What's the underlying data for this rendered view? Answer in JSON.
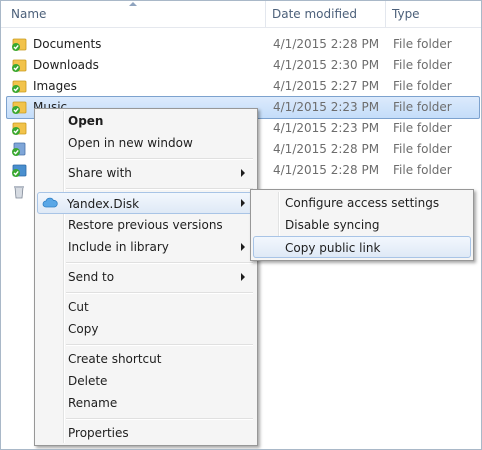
{
  "columns": {
    "name": "Name",
    "date": "Date modified",
    "type": "Type"
  },
  "rows": [
    {
      "name": "Documents",
      "date": "4/1/2015 2:28 PM",
      "type": "File folder"
    },
    {
      "name": "Downloads",
      "date": "4/1/2015 2:30 PM",
      "type": "File folder"
    },
    {
      "name": "Images",
      "date": "4/1/2015 2:27 PM",
      "type": "File folder"
    },
    {
      "name": "Music",
      "date": "4/1/2015 2:23 PM",
      "type": "File folder"
    },
    {
      "name": "",
      "date": "4/1/2015 2:23 PM",
      "type": "File folder"
    },
    {
      "name": "",
      "date": "4/1/2015 2:28 PM",
      "type": "File folder"
    },
    {
      "name": "",
      "date": "4/1/2015 2:28 PM",
      "type": "File folder"
    }
  ],
  "context_menu": {
    "open": "Open",
    "open_new_window": "Open in new window",
    "share_with": "Share with",
    "yandex_disk": "Yandex.Disk",
    "restore_previous": "Restore previous versions",
    "include_library": "Include in library",
    "send_to": "Send to",
    "cut": "Cut",
    "copy": "Copy",
    "create_shortcut": "Create shortcut",
    "delete": "Delete",
    "rename": "Rename",
    "properties": "Properties"
  },
  "submenu": {
    "configure_access": "Configure access settings",
    "disable_syncing": "Disable syncing",
    "copy_public_link": "Copy public link"
  },
  "colors": {
    "selection": "#c4ddf9",
    "check_green": "#3aa830",
    "folder_yellow": "#f2c34b"
  }
}
